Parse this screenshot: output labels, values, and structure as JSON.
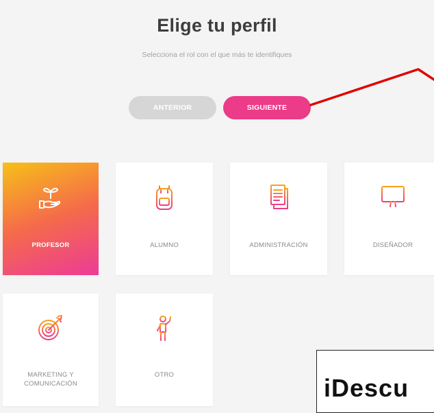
{
  "header": {
    "title": "Elige tu perfil",
    "subtitle": "Selecciona el rol con el que más te identifiques"
  },
  "buttons": {
    "previous": "ANTERIOR",
    "next": "SIGUIENTE"
  },
  "roles": [
    {
      "label": "PROFESOR",
      "icon": "plant-hand-icon",
      "selected": true
    },
    {
      "label": "ALUMNO",
      "icon": "backpack-icon",
      "selected": false
    },
    {
      "label": "ADMINISTRACIÓN",
      "icon": "documents-icon",
      "selected": false
    },
    {
      "label": "DISEÑADOR",
      "icon": "monitor-icon",
      "selected": false
    },
    {
      "label": "MARKETING Y COMUNICACIÓN",
      "icon": "target-icon",
      "selected": false
    },
    {
      "label": "OTRO",
      "icon": "person-icon",
      "selected": false
    }
  ],
  "ad": {
    "text": "iDescu"
  },
  "colors": {
    "accent": "#ec3b88",
    "disabled": "#d6d6d6",
    "icon_gradient_start": "#f7a21b",
    "icon_gradient_end": "#ec3b88",
    "annotation_arrow": "#e00000"
  }
}
